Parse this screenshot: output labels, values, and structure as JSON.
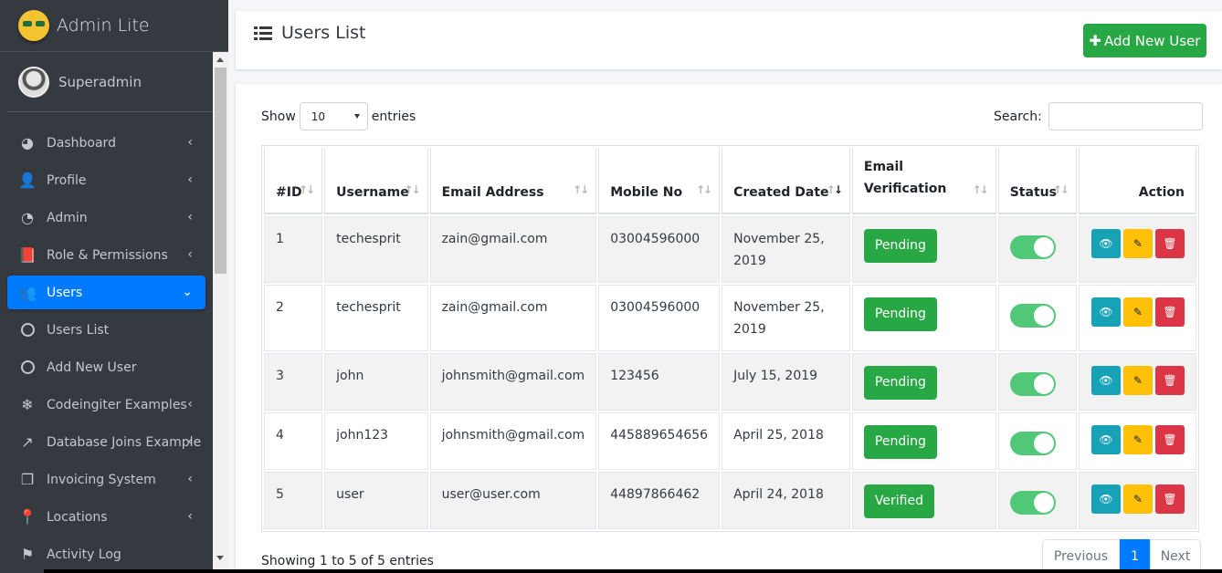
{
  "brand": {
    "name": "Admin Lite"
  },
  "user_panel": {
    "name": "Superadmin"
  },
  "sidebar": {
    "items": [
      {
        "label": "Dashboard",
        "icon": "dashboard-icon",
        "glyph": "◕",
        "chevron": "‹",
        "active": false
      },
      {
        "label": "Profile",
        "icon": "user-icon",
        "glyph": "👤",
        "chevron": "‹",
        "active": false
      },
      {
        "label": "Admin",
        "icon": "pie-chart-icon",
        "glyph": "◔",
        "chevron": "‹",
        "active": false
      },
      {
        "label": "Role & Permissions",
        "icon": "book-icon",
        "glyph": "📕",
        "chevron": "‹",
        "active": false
      },
      {
        "label": "Users",
        "icon": "users-icon",
        "glyph": "👥",
        "chevron": "⌄",
        "active": true
      },
      {
        "label": "Users List",
        "icon": "circle-icon",
        "glyph": "",
        "chevron": "",
        "active": false
      },
      {
        "label": "Add New User",
        "icon": "circle-icon",
        "glyph": "",
        "chevron": "",
        "active": false
      },
      {
        "label": "Codeingiter Examples",
        "icon": "snowflake-icon",
        "glyph": "❄",
        "chevron": "‹",
        "active": false
      },
      {
        "label": "Database Joins Example",
        "icon": "external-link-icon",
        "glyph": "↗",
        "chevron": "‹",
        "active": false
      },
      {
        "label": "Invoicing System",
        "icon": "copy-icon",
        "glyph": "❐",
        "chevron": "‹",
        "active": false
      },
      {
        "label": "Locations",
        "icon": "map-pin-icon",
        "glyph": "📍",
        "chevron": "‹",
        "active": false
      },
      {
        "label": "Activity Log",
        "icon": "flag-icon",
        "glyph": "⚑",
        "chevron": "",
        "active": false
      }
    ]
  },
  "header": {
    "title": "Users List",
    "add_button": "Add New User"
  },
  "controls": {
    "show": "Show",
    "entries_value": "10",
    "entries": "entries",
    "search_label": "Search:"
  },
  "table": {
    "columns": [
      "#ID",
      "Username",
      "Email Address",
      "Mobile No",
      "Created Date",
      "Email Verification",
      "Status",
      "Action"
    ],
    "rows": [
      {
        "id": "1",
        "username": "techesprit",
        "email": "zain@gmail.com",
        "mobile": "03004596000",
        "created": "November 25, 2019",
        "verification": "Pending"
      },
      {
        "id": "2",
        "username": "techesprit",
        "email": "zain@gmail.com",
        "mobile": "03004596000",
        "created": "November 25, 2019",
        "verification": "Pending"
      },
      {
        "id": "3",
        "username": "john",
        "email": "johnsmith@gmail.com",
        "mobile": "123456",
        "created": "July 15, 2019",
        "verification": "Pending"
      },
      {
        "id": "4",
        "username": "john123",
        "email": "johnsmith@gmail.com",
        "mobile": "445889654656",
        "created": "April 25, 2018",
        "verification": "Pending"
      },
      {
        "id": "5",
        "username": "user",
        "email": "user@user.com",
        "mobile": "44897866462",
        "created": "April 24, 2018",
        "verification": "Verified"
      }
    ]
  },
  "footer": {
    "info": "Showing 1 to 5 of 5 entries",
    "prev": "Previous",
    "page": "1",
    "next": "Next"
  },
  "colors": {
    "sidebar": "#343a40",
    "primary": "#007bff",
    "success": "#28a745",
    "info": "#17a2b8",
    "warning": "#ffc107",
    "danger": "#dc3545"
  }
}
